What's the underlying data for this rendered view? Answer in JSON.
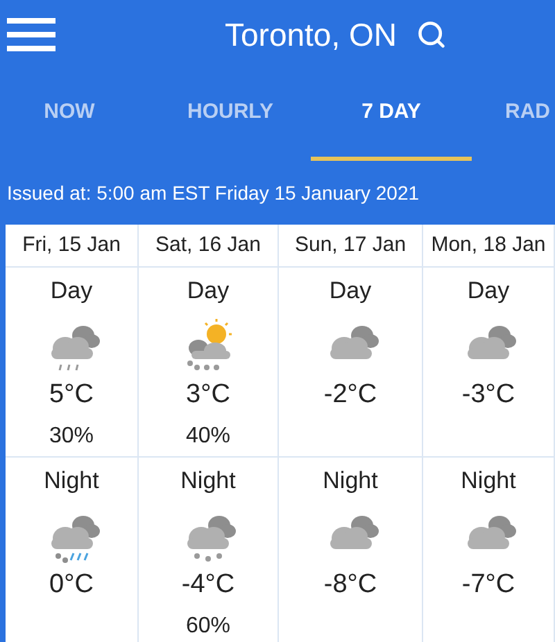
{
  "header": {
    "title": "Toronto, ON"
  },
  "tabs": [
    {
      "label": "NOW",
      "selected": false
    },
    {
      "label": "HOURLY",
      "selected": false
    },
    {
      "label": "7 DAY",
      "selected": true
    },
    {
      "label": "RAD",
      "selected": false
    }
  ],
  "issued": "Issued at: 5:00 am EST Friday 15 January 2021",
  "days": [
    {
      "date": "Fri, 15 Jan",
      "day": {
        "label": "Day",
        "kind": "rain",
        "temp": "5°C",
        "pop": "30%"
      },
      "night": {
        "label": "Night",
        "kind": "mixed",
        "temp": "0°C"
      }
    },
    {
      "date": "Sat, 16 Jan",
      "day": {
        "label": "Day",
        "kind": "sun-snow",
        "temp": "3°C",
        "pop": "40%"
      },
      "night": {
        "label": "Night",
        "kind": "snow",
        "temp": "-4°C",
        "pop": "60%"
      }
    },
    {
      "date": "Sun, 17 Jan",
      "day": {
        "label": "Day",
        "kind": "cloudy",
        "temp": "-2°C"
      },
      "night": {
        "label": "Night",
        "kind": "cloudy",
        "temp": "-8°C"
      }
    },
    {
      "date": "Mon, 18 Jan",
      "day": {
        "label": "Day",
        "kind": "cloudy",
        "temp": "-3°C"
      },
      "night": {
        "label": "Night",
        "kind": "cloudy",
        "temp": "-7°C"
      }
    }
  ]
}
